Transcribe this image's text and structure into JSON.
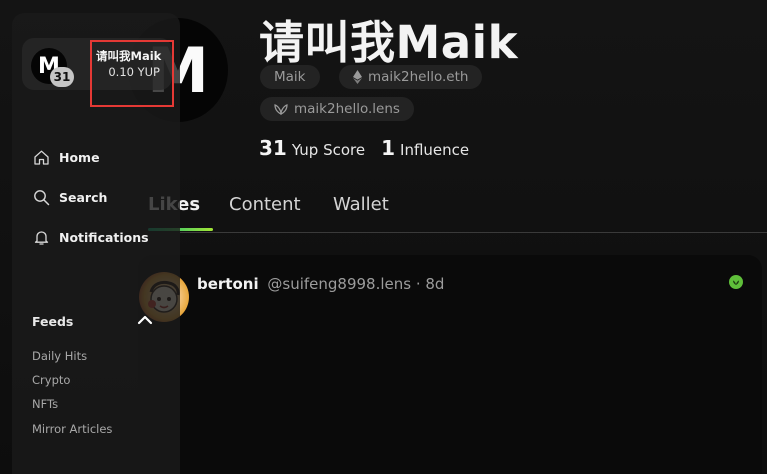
{
  "profile": {
    "avatar_letter": "M",
    "name": "请叫我Maik",
    "handles": {
      "platform": "Maik",
      "eth": "maik2hello.eth",
      "lens": "maik2hello.lens"
    },
    "stats": {
      "yup_score_value": "31",
      "yup_score_label": "Yup Score",
      "influence_value": "1",
      "influence_label": "Influence"
    }
  },
  "tabs": [
    {
      "label": "Likes",
      "active": true
    },
    {
      "label": "Content",
      "active": false
    },
    {
      "label": "Wallet",
      "active": false
    }
  ],
  "post": {
    "author": "bertoni",
    "meta": "@suifeng8998.lens · 8d"
  },
  "sidebar": {
    "user": {
      "avatar_letter": "M",
      "score": "31",
      "name": "请叫我Maik",
      "balance": "0.10 YUP"
    },
    "nav": [
      {
        "label": "Home",
        "icon": "home-icon"
      },
      {
        "label": "Search",
        "icon": "search-icon"
      },
      {
        "label": "Notifications",
        "icon": "bell-icon"
      }
    ],
    "feeds": {
      "title": "Feeds",
      "items": [
        "Daily Hits",
        "Crypto",
        "NFTs",
        "Mirror Articles"
      ]
    }
  },
  "colors": {
    "accent_gradient_start": "#10b981",
    "accent_gradient_end": "#a3e635",
    "highlight": "#e53935",
    "lens_green": "#5fbf3a"
  }
}
